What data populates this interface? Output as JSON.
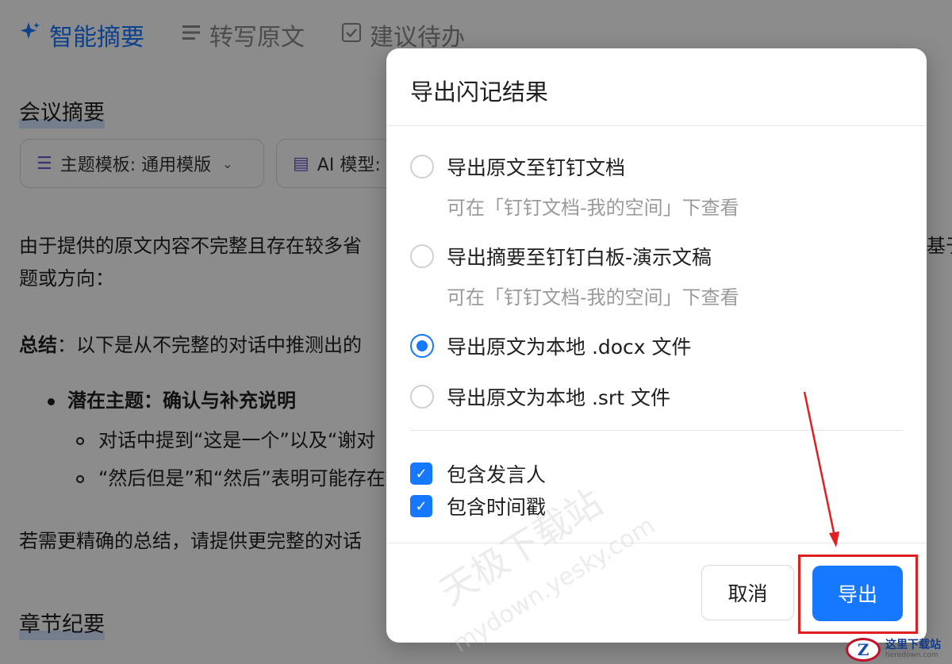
{
  "background": {
    "tabs": [
      {
        "label": "智能摘要",
        "icon": "sparkle-icon",
        "active": true
      },
      {
        "label": "转写原文",
        "icon": "list-icon",
        "active": false
      },
      {
        "label": "建议待办",
        "icon": "checkbox-icon",
        "active": false
      }
    ],
    "section_meeting_summary": "会议摘要",
    "template_selector": "主题模板: 通用模版",
    "model_selector": "AI 模型:",
    "para1_line1": "由于提供的原文内容不完整且存在较多省",
    "para1_right": "基于",
    "para1_line2": "题或方向：",
    "summary_label": "总结",
    "summary_text": "：以下是从不完整的对话中推测出的",
    "bullet_main": "潜在主题：确认与补充说明",
    "sub_bullet_1": "对话中提到“这是一个”以及“谢对",
    "sub_bullet_2": "“然后但是”和“然后”表明可能存在",
    "closing_text": "若需更精确的总结，请提供更完整的对话",
    "section_chapter": "章节纪要"
  },
  "dialog": {
    "title": "导出闪记结果",
    "options": [
      {
        "label": "导出原文至钉钉文档",
        "hint": "可在「钉钉文档-我的空间」下查看",
        "selected": false
      },
      {
        "label": "导出摘要至钉钉白板-演示文稿",
        "hint": "可在「钉钉文档-我的空间」下查看",
        "selected": false
      },
      {
        "label": "导出原文为本地 .docx 文件",
        "selected": true
      },
      {
        "label": "导出原文为本地 .srt 文件",
        "selected": false
      }
    ],
    "checkboxes": [
      {
        "label": "包含发言人",
        "checked": true
      },
      {
        "label": "包含时间戳",
        "checked": true
      }
    ],
    "cancel_label": "取消",
    "export_label": "导出"
  },
  "watermark": {
    "main": "天极下载站",
    "sub": "mydown.yesky.com"
  },
  "site_logo": {
    "title": "这里下载站",
    "url": "heredown.com"
  },
  "colors": {
    "accent": "#1677ff",
    "annotation": "#e02020",
    "overlay": "rgba(0,0,0,0.45)"
  }
}
